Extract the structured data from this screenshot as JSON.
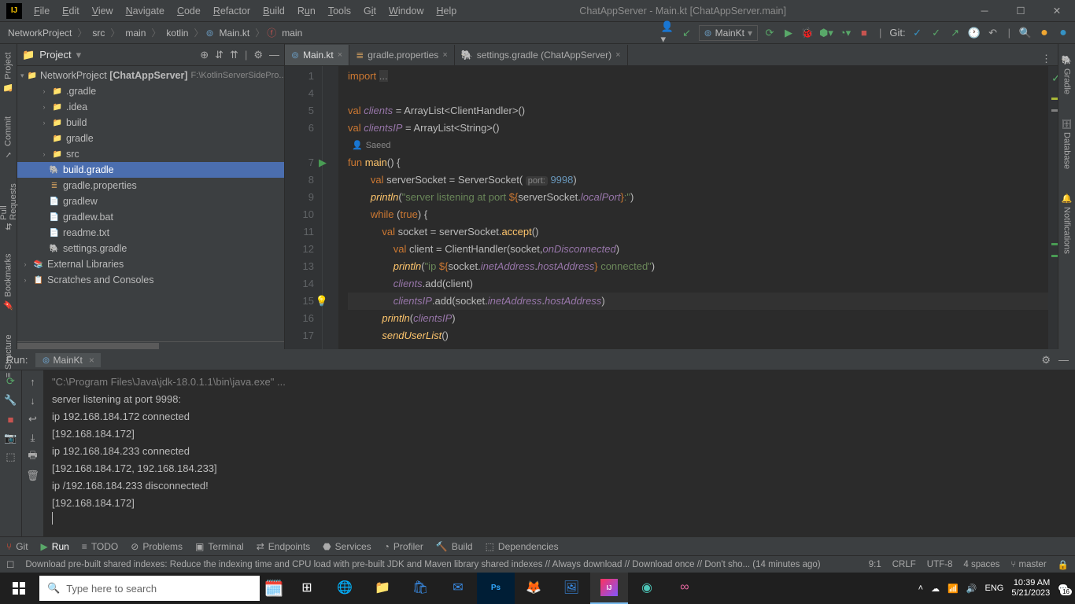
{
  "title": "ChatAppServer - Main.kt [ChatAppServer.main]",
  "menu": [
    "File",
    "Edit",
    "View",
    "Navigate",
    "Code",
    "Refactor",
    "Build",
    "Run",
    "Tools",
    "Git",
    "Window",
    "Help"
  ],
  "breadcrumb": {
    "items": [
      "NetworkProject",
      "src",
      "main",
      "kotlin",
      "Main.kt",
      "main"
    ]
  },
  "run_config": "MainKt",
  "git_label": "Git:",
  "panel": {
    "title": "Project"
  },
  "tree": {
    "root": "NetworkProject",
    "root_suffix": "[ChatAppServer]",
    "root_path": "F:\\KotlinServerSidePro...",
    "items": [
      {
        "indent": 1,
        "arrow": ">",
        "icon": "folder-o",
        "label": ".gradle"
      },
      {
        "indent": 1,
        "arrow": ">",
        "icon": "folder-g",
        "label": ".idea"
      },
      {
        "indent": 1,
        "arrow": ">",
        "icon": "folder-o",
        "label": "build"
      },
      {
        "indent": 1,
        "arrow": "",
        "icon": "folder-g",
        "label": "gradle"
      },
      {
        "indent": 1,
        "arrow": ">",
        "icon": "folder-g",
        "label": "src"
      },
      {
        "indent": 1,
        "arrow": "",
        "icon": "file-gr",
        "label": "build.gradle",
        "selected": true
      },
      {
        "indent": 1,
        "arrow": "",
        "icon": "file-prop",
        "label": "gradle.properties"
      },
      {
        "indent": 1,
        "arrow": "",
        "icon": "file-g",
        "label": "gradlew"
      },
      {
        "indent": 1,
        "arrow": "",
        "icon": "file-g",
        "label": "gradlew.bat"
      },
      {
        "indent": 1,
        "arrow": "",
        "icon": "file-g",
        "label": "readme.txt"
      },
      {
        "indent": 1,
        "arrow": "",
        "icon": "file-gr",
        "label": "settings.gradle"
      }
    ],
    "ext1": "External Libraries",
    "ext2": "Scratches and Consoles"
  },
  "tabs": [
    {
      "label": "Main.kt",
      "active": true
    },
    {
      "label": "gradle.properties",
      "active": false
    },
    {
      "label": "settings.gradle (ChatAppServer)",
      "active": false
    }
  ],
  "author": "Saeed",
  "line_numbers": [
    "1",
    "4",
    "5",
    "6",
    "",
    "7",
    "8",
    "9",
    "10",
    "11",
    "12",
    "13",
    "14",
    "15",
    "16",
    "17"
  ],
  "run": {
    "label": "Run:",
    "tab": "MainKt",
    "lines": [
      "\"C:\\Program Files\\Java\\jdk-18.0.1.1\\bin\\java.exe\" ...",
      "server listening at port 9998:",
      "ip 192.168.184.172 connected",
      "[192.168.184.172]",
      "ip 192.168.184.233 connected",
      "[192.168.184.172, 192.168.184.233]",
      "ip /192.168.184.233 disconnected!",
      "[192.168.184.172]"
    ]
  },
  "bottom_tabs": [
    "Git",
    "Run",
    "TODO",
    "Problems",
    "Terminal",
    "Endpoints",
    "Services",
    "Profiler",
    "Build",
    "Dependencies"
  ],
  "status": {
    "msg": "Download pre-built shared indexes: Reduce the indexing time and CPU load with pre-built JDK and Maven library shared indexes // Always download // Download once // Don't sho... (14 minutes ago)",
    "pos": "9:1",
    "sep": "CRLF",
    "enc": "UTF-8",
    "indent": "4 spaces",
    "branch": "master"
  },
  "taskbar": {
    "search_placeholder": "Type here to search"
  },
  "tray": {
    "lang": "ENG",
    "time": "10:39 AM",
    "date": "5/21/2023",
    "count": "16"
  },
  "gutter_tabs": {
    "left": [
      "Project",
      "Commit",
      "Pull Requests",
      "Bookmarks",
      "Structure"
    ],
    "right": [
      "Gradle",
      "Database",
      "Notifications"
    ]
  }
}
